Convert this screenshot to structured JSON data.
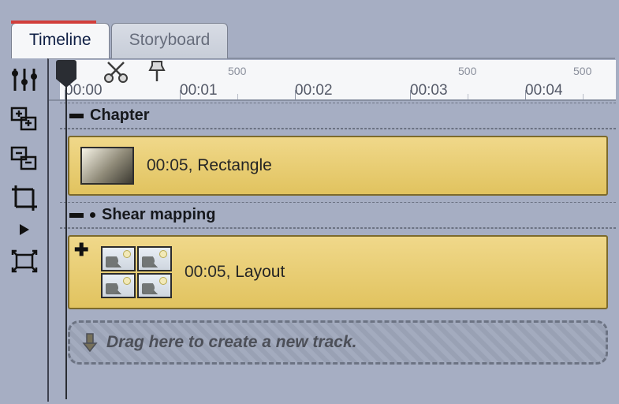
{
  "tabs": {
    "timeline": "Timeline",
    "storyboard": "Storyboard"
  },
  "ruler": {
    "major_ticks": [
      "00:00",
      "00:01",
      "00:02",
      "00:03",
      "00:04"
    ],
    "minor_label": "500",
    "minor_count": 3
  },
  "groups": [
    {
      "name": "Chapter",
      "dotted": false,
      "clip": {
        "duration": "00:05",
        "name": "Rectangle",
        "thumb": "gradient-rect",
        "expandable": false
      }
    },
    {
      "name": "Shear mapping",
      "dotted": true,
      "clip": {
        "duration": "00:05",
        "name": "Layout",
        "thumb": "layout-grid",
        "expandable": true
      }
    }
  ],
  "drop_zone": {
    "text": "Drag here to create a new track."
  },
  "toolbar": {
    "align_left": "align-tracks-icon",
    "add": "add-track-icon",
    "remove": "remove-track-icon",
    "crop": "crop-icon",
    "play": "play-icon",
    "fit": "fit-icon"
  },
  "ruler_tools": {
    "scissors": "scissors-icon",
    "marker": "marker-pin-icon"
  }
}
